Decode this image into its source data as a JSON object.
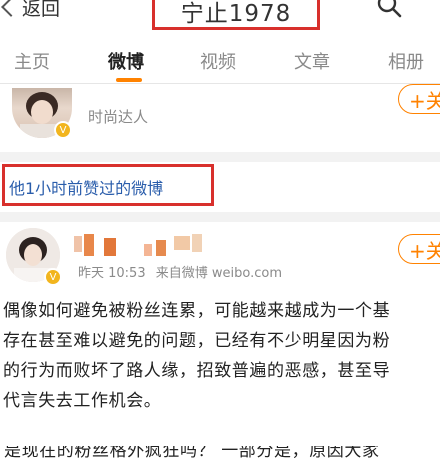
{
  "header": {
    "back_label": "返回",
    "title": "宁止1978"
  },
  "tabs": [
    {
      "label": "主页"
    },
    {
      "label": "微博"
    },
    {
      "label": "视频"
    },
    {
      "label": "文章"
    },
    {
      "label": "相册"
    }
  ],
  "user1": {
    "tag": "时尚达人",
    "follow_label": "+关"
  },
  "liked_section": {
    "label": "他1小时前赞过的微博"
  },
  "post": {
    "time": "昨天 10:53",
    "source": "来自微博 weibo.com",
    "follow_label": "+关",
    "lines": [
      "偶像如何避免被粉丝连累，可能越来越成为一个基",
      "存在甚至难以避免的问题，已经有不少明星因为粉",
      "的行为而败坏了路人缘，招致普遍的恶感，甚至导",
      "代言失去工作机会。"
    ],
    "cut_line": "是现在的粉丝格外疯狂吗？ 一部分是，原因大家"
  },
  "colors": {
    "accent": "#ff8200",
    "highlight_border": "#d8302c",
    "link_blue": "#2a5dab",
    "verify_gold": "#f2b51e"
  }
}
